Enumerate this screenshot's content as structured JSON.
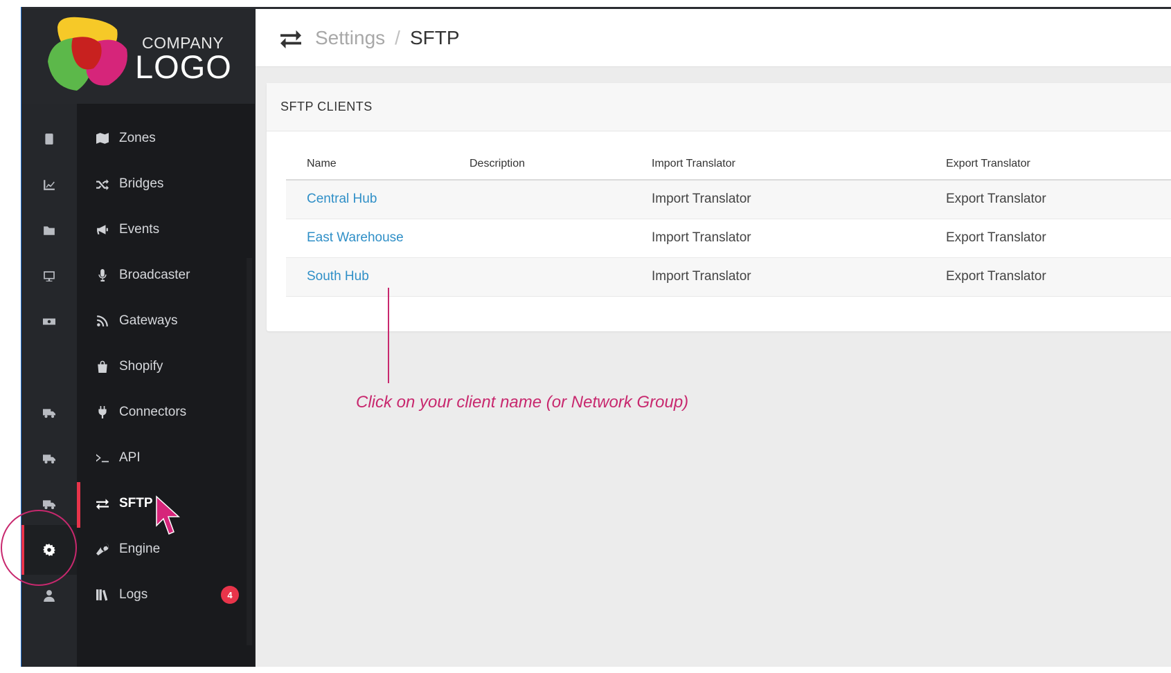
{
  "logo": {
    "line1": "COMPANY",
    "line2": "LOGO"
  },
  "rail_icons": [
    "device-icon",
    "chart-icon",
    "folder-icon",
    "monitor-icon",
    "money-icon",
    "truck-icon",
    "truck-icon",
    "truck-icon",
    "gear-icon",
    "user-icon"
  ],
  "nav": {
    "items": [
      {
        "label": "Zones",
        "icon": "map-icon"
      },
      {
        "label": "Bridges",
        "icon": "shuffle-icon"
      },
      {
        "label": "Events",
        "icon": "megaphone-icon"
      },
      {
        "label": "Broadcaster",
        "icon": "microphone-icon"
      },
      {
        "label": "Gateways",
        "icon": "rss-icon"
      },
      {
        "label": "Shopify",
        "icon": "bag-icon"
      },
      {
        "label": "Connectors",
        "icon": "plug-icon"
      },
      {
        "label": "API",
        "icon": "terminal-icon"
      },
      {
        "label": "SFTP",
        "icon": "exchange-icon",
        "active": true
      },
      {
        "label": "Engine",
        "icon": "wrench-icon"
      },
      {
        "label": "Logs",
        "icon": "books-icon",
        "badge": "4"
      }
    ]
  },
  "header": {
    "breadcrumb_parent": "Settings",
    "separator": "/",
    "breadcrumb_current": "SFTP"
  },
  "card": {
    "title": "SFTP CLIENTS",
    "columns": [
      "Name",
      "Description",
      "Import Translator",
      "Export Translator"
    ],
    "rows": [
      {
        "name": "Central Hub",
        "description": "",
        "import": "Import Translator",
        "export": "Export Translator"
      },
      {
        "name": "East Warehouse",
        "description": "",
        "import": "Import Translator",
        "export": "Export Translator"
      },
      {
        "name": "South Hub",
        "description": "",
        "import": "Import Translator",
        "export": "Export Translator"
      }
    ]
  },
  "annotation": {
    "text": "Click on your client name (or Network Group)"
  },
  "colors": {
    "accent": "#e8344a",
    "link": "#2f8fc7",
    "annotation": "#c8286e",
    "sidebar": "#191a1d"
  }
}
